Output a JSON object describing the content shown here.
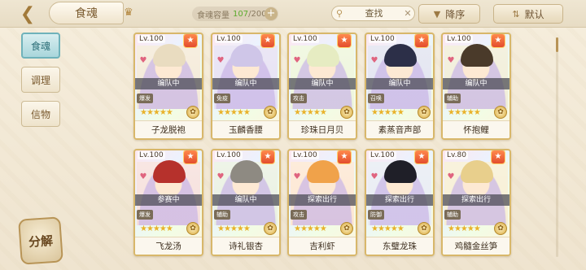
{
  "header": {
    "title": "食魂",
    "capacity_label": "食魂容量",
    "capacity_current": "107",
    "capacity_max": "200",
    "search_placeholder": "查找",
    "sort_order_label": "降序",
    "sort_mode_label": "默认"
  },
  "sidebar": {
    "tabs": [
      "食魂",
      "调理",
      "信物"
    ],
    "active_tab": 0,
    "decompose_label": "分解"
  },
  "cards": [
    {
      "level": "Lv.100",
      "status": "编队中",
      "name": "子龙脱袍",
      "type": "爆发",
      "art_color": "#f4ead8",
      "hair_color": "#e9dcc0"
    },
    {
      "level": "Lv.100",
      "status": "编队中",
      "name": "玉麟香腰",
      "type": "免疫",
      "art_color": "#e6e1f3",
      "hair_color": "#cfc6e8"
    },
    {
      "level": "Lv.100",
      "status": "编队中",
      "name": "珍珠日月贝",
      "type": "攻击",
      "art_color": "#eef6dc",
      "hair_color": "#e6ecc2"
    },
    {
      "level": "Lv.100",
      "status": "编队中",
      "name": "素蒸音声部",
      "type": "召唤",
      "art_color": "#e2e4f0",
      "hair_color": "#2c2f48"
    },
    {
      "level": "Lv.100",
      "status": "编队中",
      "name": "怀抱鲤",
      "type": "辅助",
      "art_color": "#f1eed8",
      "hair_color": "#4a3a2a"
    },
    {
      "level": "Lv.100",
      "status": "参赛中",
      "name": "飞龙汤",
      "type": "爆发",
      "art_color": "#f6e0dc",
      "hair_color": "#b6312c"
    },
    {
      "level": "Lv.100",
      "status": "编队中",
      "name": "诗礼银杏",
      "type": "辅助",
      "art_color": "#eaf1e2",
      "hair_color": "#8e8a82"
    },
    {
      "level": "Lv.100",
      "status": "探索出行",
      "name": "吉利虾",
      "type": "攻击",
      "art_color": "#fde7d2",
      "hair_color": "#f0a24a"
    },
    {
      "level": "Lv.100",
      "status": "探索出行",
      "name": "东璧龙珠",
      "type": "防御",
      "art_color": "#e8ecf3",
      "hair_color": "#1f1f28"
    },
    {
      "level": "Lv.80",
      "status": "探索出行",
      "name": "鸡髓金丝笋",
      "type": "辅助",
      "art_color": "#f7efd4",
      "hair_color": "#e8cf8c"
    }
  ],
  "icons": {
    "back": "back-arrow-icon",
    "crown": "crown-icon",
    "search": "magnifier-icon",
    "clear": "close-icon",
    "favorite": "heart-icon",
    "quality": "gold-medal-icon"
  },
  "colors": {
    "accent": "#b89456",
    "active_tab": "#6fb2ba",
    "capacity_current": "#5cab2d",
    "card_badge": "#e34c2d"
  }
}
